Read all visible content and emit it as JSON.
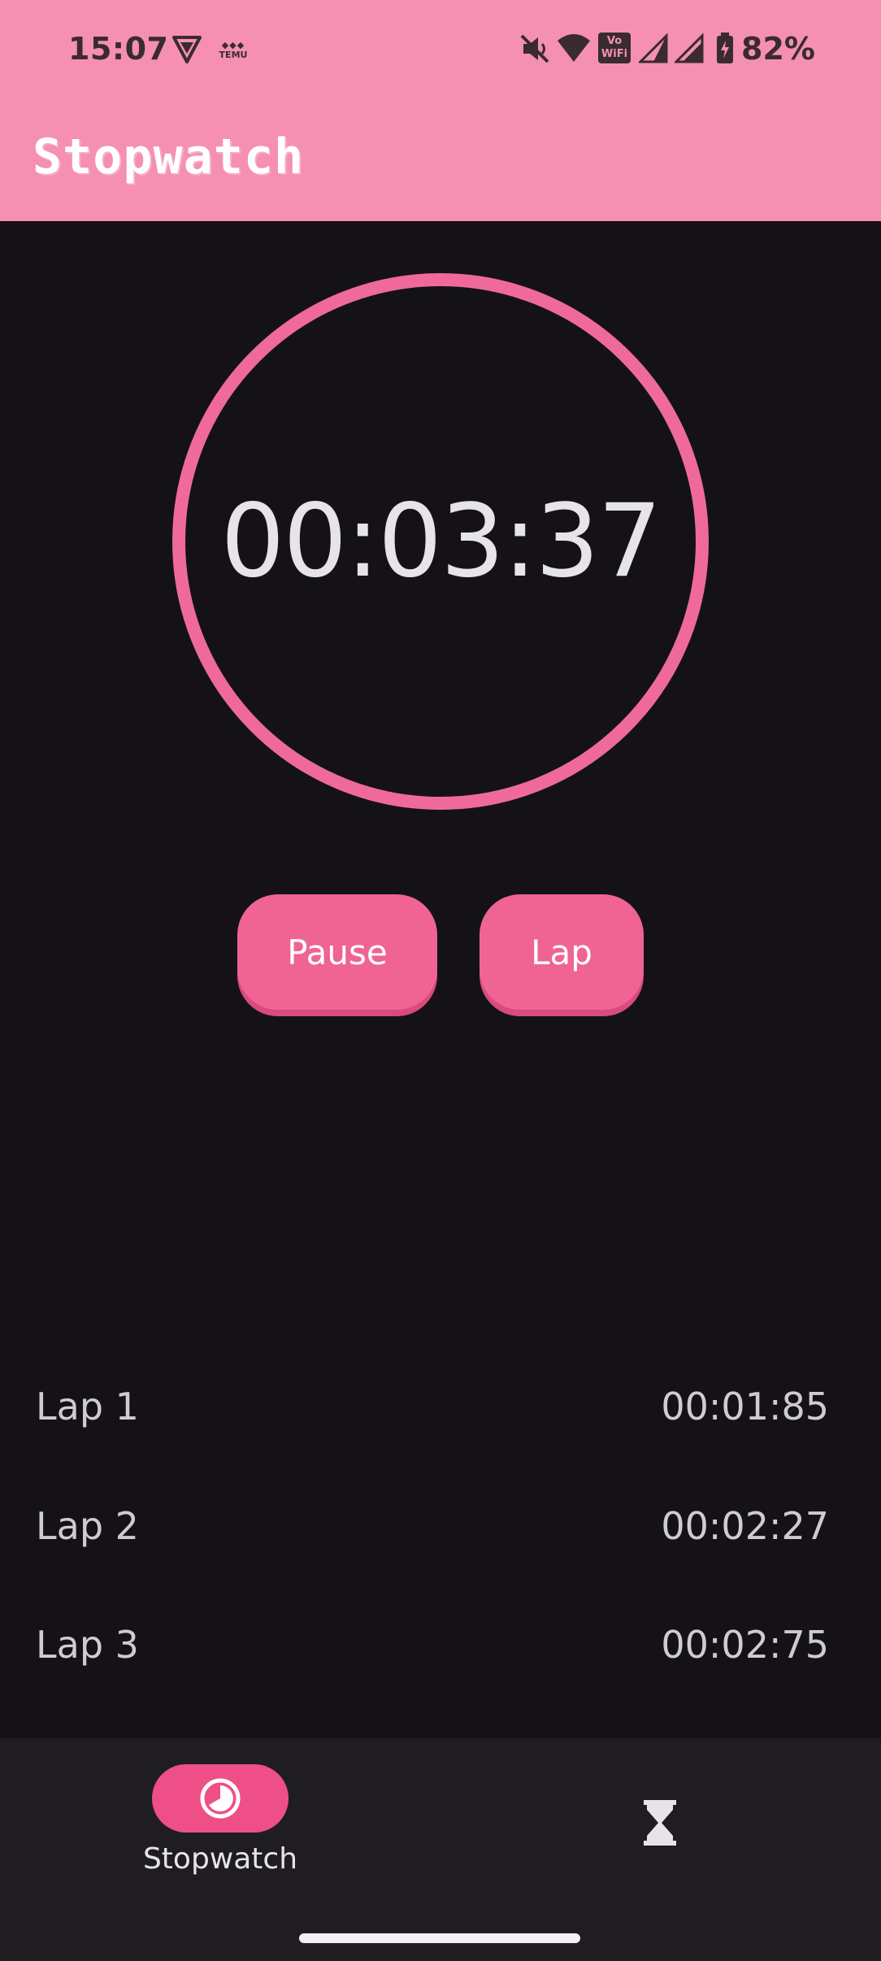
{
  "status_bar": {
    "time": "15:07",
    "left_icons": [
      "shield-icon",
      "temu-icon"
    ],
    "right_icons": [
      "mute-icon",
      "wifi-icon",
      "vowifi-icon",
      "signal-icon",
      "signal-icon",
      "battery-icon"
    ],
    "vowifi_text": "Vo WiFi",
    "temu_text": "TEMU",
    "battery_percent": "82%"
  },
  "app_bar": {
    "title": "Stopwatch"
  },
  "timer": {
    "display": "00:03:37"
  },
  "controls": {
    "pause_label": "Pause",
    "lap_label": "Lap"
  },
  "laps": [
    {
      "label": "Lap 1",
      "time": "00:01:85"
    },
    {
      "label": "Lap 2",
      "time": "00:02:27"
    },
    {
      "label": "Lap 3",
      "time": "00:02:75"
    }
  ],
  "bottom_nav": {
    "items": [
      {
        "label": "Stopwatch",
        "icon": "stopwatch-icon",
        "selected": true
      },
      {
        "label": "",
        "icon": "hourglass-icon",
        "selected": false
      }
    ]
  },
  "colors": {
    "app_bar": "#f590b2",
    "accent": "#ef6493",
    "background": "#141217",
    "nav_background": "#1f1d22"
  }
}
